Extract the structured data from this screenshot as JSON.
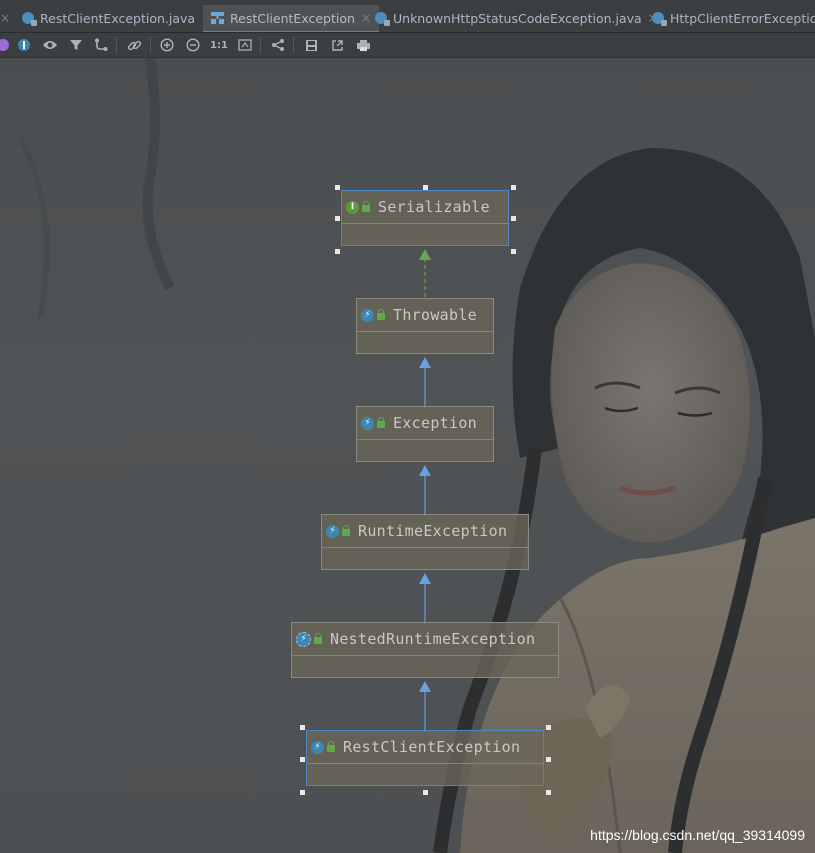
{
  "tabs": [
    {
      "label": "RestClientException.java",
      "active": false
    },
    {
      "label": "RestClientException",
      "active": true
    },
    {
      "label": "UnknownHttpStatusCodeException.java",
      "active": false
    },
    {
      "label": "HttpClientErrorException",
      "active": false
    }
  ],
  "tab_close_glyph": "×",
  "toolbar": {
    "actual_size_label": "1:1"
  },
  "diagram": {
    "nodes": [
      {
        "label": "Serializable",
        "kind": "interface",
        "icon_letter": "I"
      },
      {
        "label": "Throwable",
        "kind": "class",
        "icon_letter": ""
      },
      {
        "label": "Exception",
        "kind": "class",
        "icon_letter": ""
      },
      {
        "label": "RuntimeException",
        "kind": "class",
        "icon_letter": ""
      },
      {
        "label": "NestedRuntimeException",
        "kind": "abstract-class",
        "icon_letter": ""
      },
      {
        "label": "RestClientException",
        "kind": "class",
        "icon_letter": ""
      }
    ]
  },
  "colors": {
    "accent": "#4a88c7",
    "extends_arrow": "#6a9fe0",
    "implements_arrow": "#6aa84f"
  },
  "watermark": "https://blog.csdn.net/qq_39314099"
}
